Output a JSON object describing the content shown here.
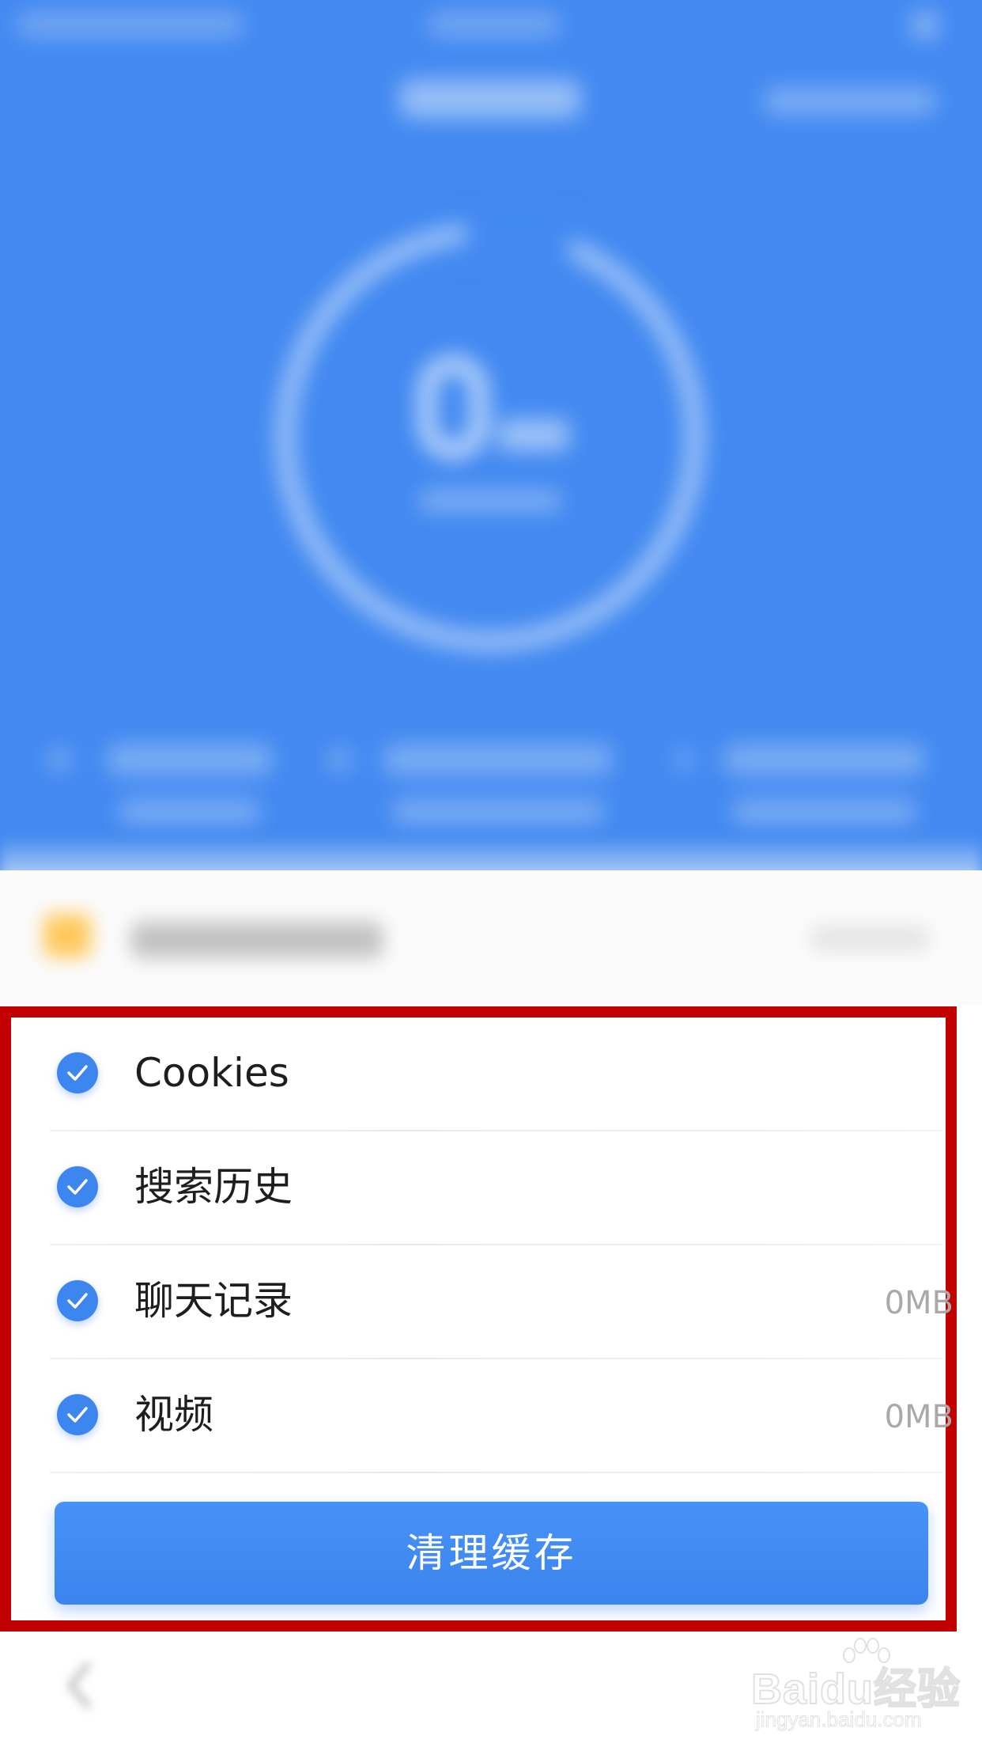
{
  "colors": {
    "header_blue": "#4289f1",
    "accent_blue": "#3e86ef",
    "highlight_red": "#c20000",
    "size_gray": "#a9a9a9"
  },
  "cache_items": [
    {
      "label": "Cookies",
      "size": "",
      "checked": true
    },
    {
      "label": "搜索历史",
      "size": "",
      "checked": true
    },
    {
      "label": "聊天记录",
      "size": "0MB",
      "checked": true
    },
    {
      "label": "视频",
      "size": "0MB",
      "checked": true
    }
  ],
  "clear_button": {
    "label": "清理缓存"
  },
  "watermark": {
    "brand": "Baidu经验",
    "url": "jingyan.baidu.com"
  },
  "icons": {
    "check": "check-icon",
    "folder": "folder-icon",
    "back": "back-arrow-icon"
  }
}
